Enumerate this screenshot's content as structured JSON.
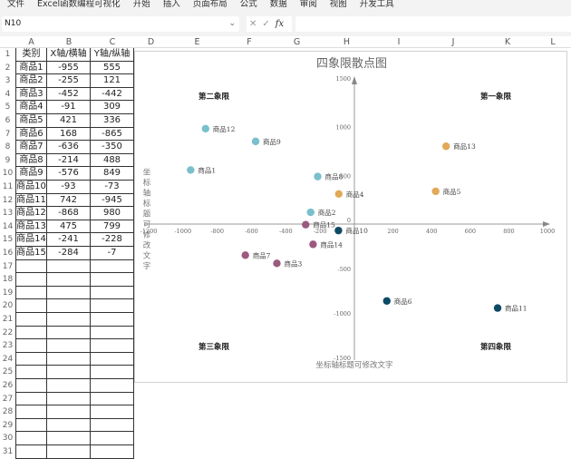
{
  "menu": [
    "文件",
    "Excel函数编程可视化",
    "开始",
    "插入",
    "页面布局",
    "公式",
    "数据",
    "审阅",
    "视图",
    "开发工具"
  ],
  "formula_bar": {
    "name_box": "N10",
    "fx": "fx",
    "cancel": "✕",
    "confirm": "✓",
    "value": ""
  },
  "columns": [
    "A",
    "B",
    "C",
    "D",
    "E",
    "F",
    "G",
    "H",
    "I",
    "J",
    "K",
    "L"
  ],
  "table": {
    "headers": [
      "类别",
      "X轴/横轴",
      "Y轴/纵轴"
    ],
    "rows": [
      [
        "商品1",
        "-955",
        "555"
      ],
      [
        "商品2",
        "-255",
        "121"
      ],
      [
        "商品3",
        "-452",
        "-442"
      ],
      [
        "商品4",
        "-91",
        "309"
      ],
      [
        "商品5",
        "421",
        "336"
      ],
      [
        "商品6",
        "168",
        "-865"
      ],
      [
        "商品7",
        "-636",
        "-350"
      ],
      [
        "商品8",
        "-214",
        "488"
      ],
      [
        "商品9",
        "-576",
        "849"
      ],
      [
        "商品10",
        "-93",
        "-73"
      ],
      [
        "商品11",
        "742",
        "-945"
      ],
      [
        "商品12",
        "-868",
        "980"
      ],
      [
        "商品13",
        "475",
        "799"
      ],
      [
        "商品14",
        "-241",
        "-228"
      ],
      [
        "商品15",
        "-284",
        "-7"
      ]
    ],
    "row_count": 31
  },
  "chart_data": {
    "type": "scatter",
    "title": "四象限散点图",
    "xlabel": "坐标轴标题可修改文字",
    "ylabel": "坐标轴标题可修改文字",
    "xlim": [
      -1200,
      1000
    ],
    "ylim": [
      -1500,
      1500
    ],
    "x_ticks": [
      "-1200",
      "-1000",
      "-800",
      "-600",
      "-400",
      "-200",
      "0",
      "200",
      "400",
      "600",
      "800",
      "1000"
    ],
    "x_tick_values": [
      -1200,
      -1000,
      -800,
      -600,
      -400,
      -200,
      0,
      200,
      400,
      600,
      800,
      1000
    ],
    "y_ticks": [
      "1500",
      "1000",
      "500",
      "0",
      "-500",
      "-1000",
      "-1500"
    ],
    "y_tick_values": [
      1500,
      1000,
      500,
      0,
      -500,
      -1000,
      -1500
    ],
    "quadrants": [
      "第一象限",
      "第二象限",
      "第三象限",
      "第四象限"
    ],
    "colors": {
      "teal": "#79bfcc",
      "orange": "#e2a95a",
      "purple": "#9b5a80",
      "navy": "#0d4a66"
    },
    "points": [
      {
        "name": "商品1",
        "x": -955,
        "y": 555,
        "color": "#79bfcc"
      },
      {
        "name": "商品2",
        "x": -255,
        "y": 121,
        "color": "#79bfcc"
      },
      {
        "name": "商品3",
        "x": -452,
        "y": -442,
        "color": "#9b5a80"
      },
      {
        "name": "商品4",
        "x": -91,
        "y": 309,
        "color": "#e2a95a"
      },
      {
        "name": "商品5",
        "x": 421,
        "y": 336,
        "color": "#e2a95a"
      },
      {
        "name": "商品6",
        "x": 168,
        "y": -865,
        "color": "#0d4a66"
      },
      {
        "name": "商品7",
        "x": -636,
        "y": -350,
        "color": "#9b5a80"
      },
      {
        "name": "商品8",
        "x": -214,
        "y": 488,
        "color": "#79bfcc"
      },
      {
        "name": "商品9",
        "x": -576,
        "y": 849,
        "color": "#79bfcc"
      },
      {
        "name": "商品10",
        "x": -93,
        "y": -73,
        "color": "#0d4a66"
      },
      {
        "name": "商品11",
        "x": 742,
        "y": -945,
        "color": "#0d4a66"
      },
      {
        "name": "商品12",
        "x": -868,
        "y": 980,
        "color": "#79bfcc"
      },
      {
        "name": "商品13",
        "x": 475,
        "y": 799,
        "color": "#e2a95a"
      },
      {
        "name": "商品14",
        "x": -241,
        "y": -228,
        "color": "#9b5a80"
      },
      {
        "name": "商品15",
        "x": -284,
        "y": -7,
        "color": "#9b5a80"
      }
    ]
  }
}
